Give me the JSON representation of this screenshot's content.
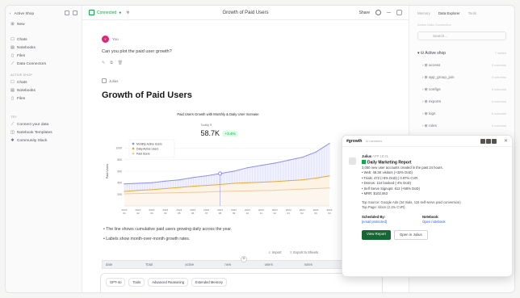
{
  "sidebar": {
    "workspace": "Active Shop",
    "new_label": "New",
    "primary": [
      {
        "icon": "chat-icon",
        "label": "Chats"
      },
      {
        "icon": "notebook-icon",
        "label": "Notebooks"
      },
      {
        "icon": "file-icon",
        "label": "Files"
      },
      {
        "icon": "connector-icon",
        "label": "Data Connectors"
      }
    ],
    "section_label": "ACTIVE SHOP",
    "secondary": [
      {
        "icon": "chat-icon",
        "label": "Chats"
      },
      {
        "icon": "notebook-icon",
        "label": "Notebooks"
      },
      {
        "icon": "file-icon",
        "label": "Files"
      }
    ],
    "section2_label": "TRY",
    "tertiary": [
      {
        "icon": "connector-icon",
        "label": "Connect your data"
      },
      {
        "icon": "template-icon",
        "label": "Notebook Templates"
      },
      {
        "icon": "community-icon",
        "label": "Community Slack"
      }
    ]
  },
  "header": {
    "status": "Connected",
    "title": "Growth of Paid Users",
    "share_label": "Share"
  },
  "chat": {
    "user_name": "You",
    "user_initial": "Y",
    "question": "Can you plot the paid user growth?",
    "agent_name": "Julius",
    "heading": "Growth of Paid Users",
    "bullets": [
      "• The line shows cumulative paid users growing daily across the year.",
      "• Labels show month-over-month growth rates."
    ],
    "table_actions": [
      "Import",
      "Export to Sheets"
    ],
    "table_columns": [
      "date",
      "Total",
      "active",
      "new",
      "users",
      "notes",
      "paid"
    ],
    "composer_chips": [
      "GPT-4o",
      "Tools",
      "Advanced Reasoning",
      "Extended Memory"
    ]
  },
  "chart_data": {
    "type": "line",
    "title": "Paid Users Growth with Monthly & Daily User Increase",
    "ylabel": "Paid Users",
    "x": [
      "2023-01",
      "2023-02",
      "2023-03",
      "2023-04",
      "2023-05",
      "2023-06",
      "2023-07",
      "2023-08",
      "2023-09",
      "2023-10",
      "2023-11",
      "2023-12",
      "2024-01",
      "2024-02",
      "2024-03",
      "2024-04"
    ],
    "ylim": [
      0,
      1200
    ],
    "yticks": [
      200,
      400,
      600,
      800,
      1000
    ],
    "series": [
      {
        "name": "Monthly Active Users",
        "color": "#8b8ff0",
        "values": [
          380,
          390,
          400,
          430,
          450,
          490,
          520,
          560,
          600,
          660,
          700,
          740,
          790,
          840,
          930,
          1080
        ]
      },
      {
        "name": "Daily Active Users",
        "color": "#e5a93a",
        "values": [
          250,
          270,
          280,
          300,
          320,
          340,
          355,
          370,
          390,
          400,
          410,
          420,
          435,
          450,
          480,
          520
        ]
      },
      {
        "name": "Paid Users",
        "color": "#f0c9a0",
        "values": [
          210,
          215,
          220,
          225,
          230,
          235,
          240,
          250,
          255,
          260,
          265,
          270,
          280,
          290,
          300,
          310
        ]
      }
    ],
    "tooltip": {
      "label": "Tooltip S",
      "value": "58.7K",
      "delta": "+3.4%"
    }
  },
  "right_panel": {
    "tabs": [
      "Memory",
      "Data Explorer",
      "Tools"
    ],
    "active_tab": "Data Explorer",
    "subtitle": "Active Data Connection",
    "search_placeholder": "Search...",
    "source": {
      "name": "Active shop",
      "count": "7 tables"
    },
    "tables": [
      {
        "name": "access",
        "count": "3 columns"
      },
      {
        "name": "app_group_join",
        "count": "3 columns"
      },
      {
        "name": "configs",
        "count": "5 columns"
      },
      {
        "name": "exports",
        "count": "4 columns"
      },
      {
        "name": "logs",
        "count": "6 columns"
      },
      {
        "name": "roles",
        "count": "3 columns"
      }
    ]
  },
  "popup": {
    "channel": "#growth",
    "members": "11 members",
    "sender": "Julius",
    "sender_tag": "APP",
    "time": "10:41",
    "report_title": "Daily Marketing Report",
    "intro": "3,050 new user accounts created in the past 24 hours.",
    "stats": [
      "• Web: 48.3K visitors (+32% DoD)",
      "• Trials: 472 (+6% DoD) | 0.97% CVR",
      "• Demos: 124 booked (-4% DoD)",
      "• Self Serve Signups: 612 (+58% DoD)",
      "• MRR: $102,063"
    ],
    "top_source": "Top Source: Google Ads (34 trials, 116 self-serve paid conversion)",
    "top_page": "Top Page: /docs (2.1% CVR)",
    "scheduled_label": "Scheduled By:",
    "scheduled_value": "[email protected]",
    "notebook_label": "Notebook:",
    "notebook_value": "Open notebook",
    "btn_primary": "View Report",
    "btn_secondary": "Open in Julius"
  }
}
